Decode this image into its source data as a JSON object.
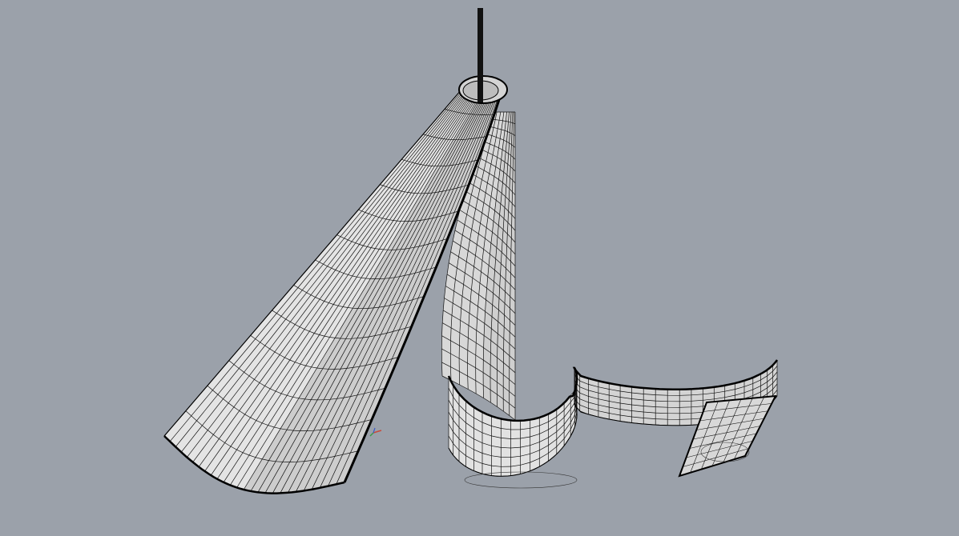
{
  "viewport": {
    "background": "#9ba1aa",
    "surface_fill": "#dcdcdc",
    "surface_shade": "#c4c4c4",
    "wire_color": "#111111",
    "edge_color": "#000000"
  },
  "objects": [
    {
      "name": "sloped-cone-surface"
    },
    {
      "name": "vertical-curved-wall"
    },
    {
      "name": "s-curve-ribbon-wall"
    },
    {
      "name": "vertical-pole"
    }
  ],
  "gizmo": {
    "icon": "origin-axes-icon"
  }
}
